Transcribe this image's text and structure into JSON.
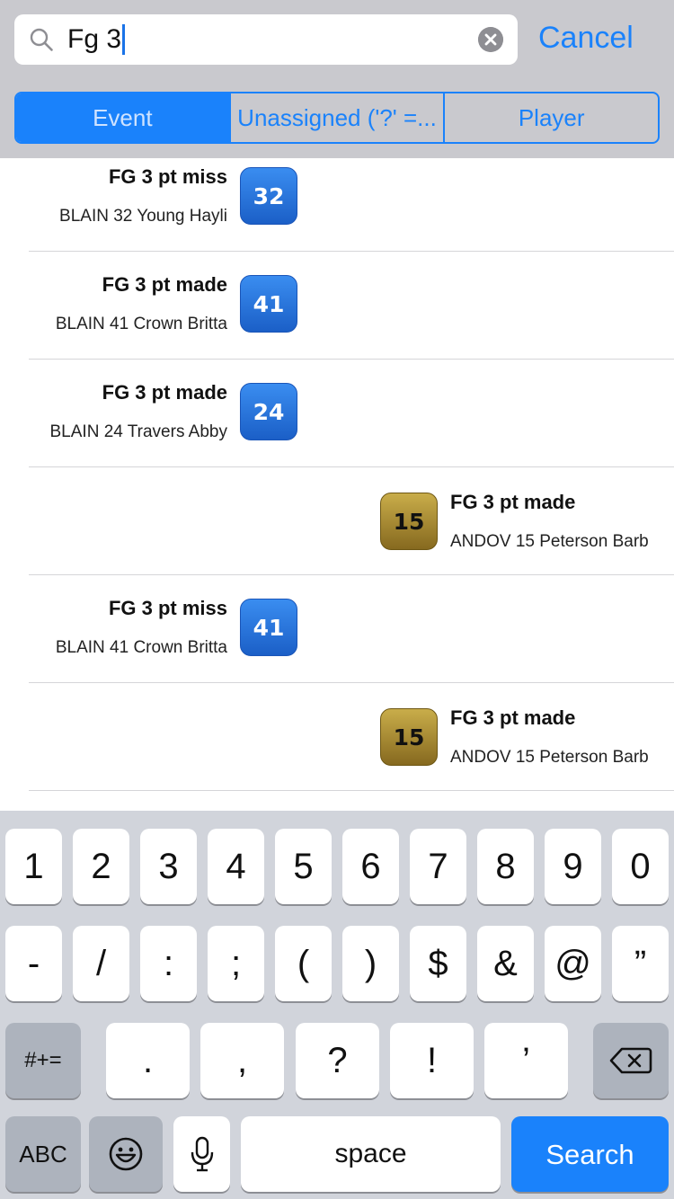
{
  "search": {
    "value": "Fg 3",
    "cancel_label": "Cancel"
  },
  "segments": [
    {
      "label": "Event",
      "active": true
    },
    {
      "label": "Unassigned ('?' =...",
      "active": false
    },
    {
      "label": "Player",
      "active": false
    }
  ],
  "rows": [
    {
      "title": "FG 3 pt miss",
      "subtitle": "BLAIN 32 Young Hayli",
      "number": "32",
      "team": "home"
    },
    {
      "title": "FG 3 pt made",
      "subtitle": "BLAIN 41 Crown Britta",
      "number": "41",
      "team": "home"
    },
    {
      "title": "FG 3 pt made",
      "subtitle": "BLAIN 24 Travers Abby",
      "number": "24",
      "team": "home"
    },
    {
      "title": "FG 3 pt made",
      "subtitle": "ANDOV 15 Peterson Barb",
      "number": "15",
      "team": "away"
    },
    {
      "title": "FG 3 pt miss",
      "subtitle": "BLAIN 41 Crown Britta",
      "number": "41",
      "team": "home"
    },
    {
      "title": "FG 3 pt made",
      "subtitle": "ANDOV 15 Peterson Barb",
      "number": "15",
      "team": "away"
    }
  ],
  "keyboard": {
    "row1": [
      "1",
      "2",
      "3",
      "4",
      "5",
      "6",
      "7",
      "8",
      "9",
      "0"
    ],
    "row2": [
      "-",
      "/",
      ":",
      ";",
      "(",
      ")",
      "$",
      "&",
      "@",
      "”"
    ],
    "row3": [
      ".",
      ",",
      "?",
      "!",
      "’"
    ],
    "symbols_label": "#+=",
    "abc_label": "ABC",
    "space_label": "space",
    "search_label": "Search"
  },
  "colors": {
    "accent": "#1a82fb",
    "home_badge": "#2a74dc",
    "away_badge": "#a8892f"
  }
}
